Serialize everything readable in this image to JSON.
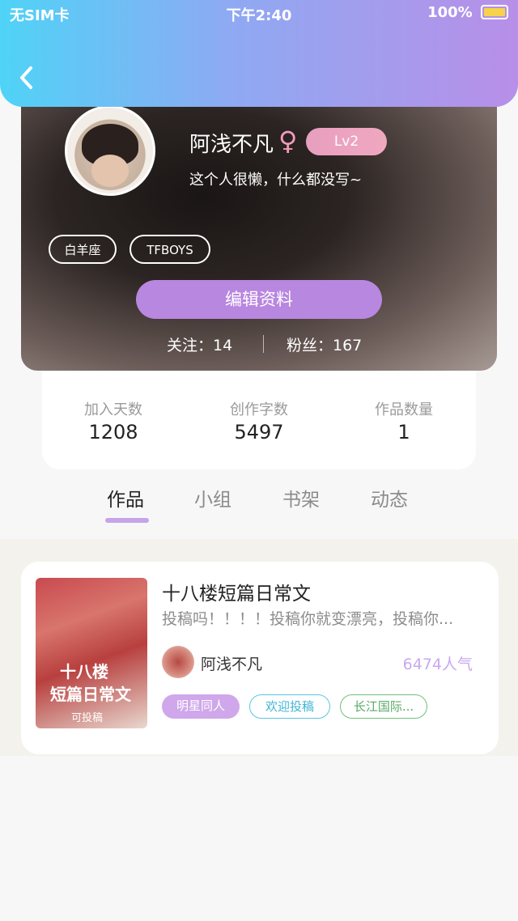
{
  "status_bar": {
    "carrier": "无SIM卡",
    "time": "下午2:40",
    "battery": "100%"
  },
  "profile": {
    "name": "阿浅不凡",
    "gender_symbol": "♀",
    "level": "Lv2",
    "bio": "这个人很懒，什么都没写~",
    "tags": [
      "白羊座",
      "TFBOYS"
    ],
    "edit_button": "编辑资料",
    "follow_label": "关注：14",
    "fans_label": "粉丝：167"
  },
  "stats": [
    {
      "label": "加入天数",
      "value": "1208"
    },
    {
      "label": "创作字数",
      "value": "5497"
    },
    {
      "label": "作品数量",
      "value": "1"
    }
  ],
  "tabs": [
    "作品",
    "小组",
    "书架",
    "动态"
  ],
  "active_tab": "作品",
  "work": {
    "title": "十八楼短篇日常文",
    "description": "投稿吗！！！！投稿你就变漂亮，投稿你...",
    "author": "阿浅不凡",
    "popularity": "6474人气",
    "cover_text_line1": "十八楼",
    "cover_text_line2": "短篇日常文",
    "cover_text_line3": "可投稿",
    "tags": [
      "明星同人",
      "欢迎投稿",
      "长江国际..."
    ]
  }
}
